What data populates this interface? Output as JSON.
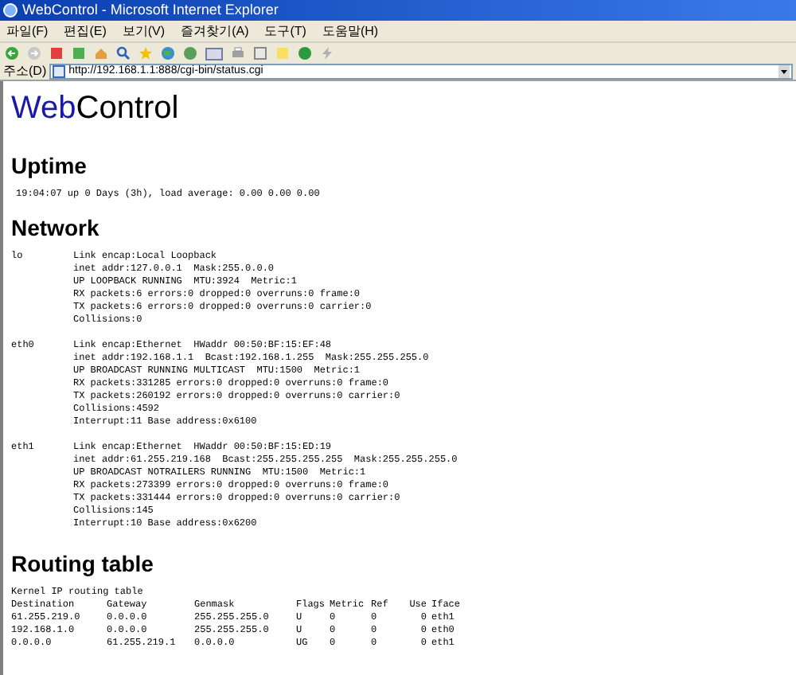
{
  "window": {
    "title": "WebControl - Microsoft Internet Explorer"
  },
  "menu": [
    "파일(F)",
    "편집(E)",
    "보기(V)",
    "즐겨찾기(A)",
    "도구(T)",
    "도움말(H)"
  ],
  "address_bar": {
    "label": "주소(D)",
    "value": "http://192.168.1.1:888/cgi-bin/status.cgi"
  },
  "page": {
    "logo": [
      {
        "text": "Web",
        "kind": "accent"
      },
      {
        "text": "Control",
        "kind": "plain"
      }
    ],
    "uptime": {
      "heading": "Uptime",
      "text": "19:04:07 up 0 Days (3h), load average: 0.00 0.00 0.00"
    },
    "network": {
      "heading": "Network",
      "interfaces": [
        {
          "name": "lo",
          "lines": [
            "Link encap:Local Loopback",
            "inet addr:127.0.0.1  Mask:255.0.0.0",
            "UP LOOPBACK RUNNING  MTU:3924  Metric:1",
            "RX packets:6 errors:0 dropped:0 overruns:0 frame:0",
            "TX packets:6 errors:0 dropped:0 overruns:0 carrier:0",
            "Collisions:0"
          ]
        },
        {
          "name": "eth0",
          "lines": [
            "Link encap:Ethernet  HWaddr 00:50:BF:15:EF:48",
            "inet addr:192.168.1.1  Bcast:192.168.1.255  Mask:255.255.255.0",
            "UP BROADCAST RUNNING MULTICAST  MTU:1500  Metric:1",
            "RX packets:331285 errors:0 dropped:0 overruns:0 frame:0",
            "TX packets:260192 errors:0 dropped:0 overruns:0 carrier:0",
            "Collisions:4592",
            "Interrupt:11 Base address:0x6100"
          ]
        },
        {
          "name": "eth1",
          "lines": [
            "Link encap:Ethernet  HWaddr 00:50:BF:15:ED:19",
            "inet addr:61.255.219.168  Bcast:255.255.255.255  Mask:255.255.255.0",
            "UP BROADCAST NOTRAILERS RUNNING  MTU:1500  Metric:1",
            "RX packets:273399 errors:0 dropped:0 overruns:0 frame:0",
            "TX packets:331444 errors:0 dropped:0 overruns:0 carrier:0",
            "Collisions:145",
            "Interrupt:10 Base address:0x6200"
          ]
        }
      ]
    },
    "routing": {
      "heading": "Routing table",
      "caption": "Kernel IP routing table",
      "columns": [
        "Destination",
        "Gateway",
        "Genmask",
        "Flags",
        "Metric",
        "Ref",
        "Use",
        "Iface"
      ],
      "rows": [
        [
          "61.255.219.0",
          "0.0.0.0",
          "255.255.255.0",
          "U",
          "0",
          "0",
          "0",
          "eth1"
        ],
        [
          "192.168.1.0",
          "0.0.0.0",
          "255.255.255.0",
          "U",
          "0",
          "0",
          "0",
          "eth0"
        ],
        [
          "0.0.0.0",
          "61.255.219.1",
          "0.0.0.0",
          "UG",
          "0",
          "0",
          "0",
          "eth1"
        ]
      ]
    }
  }
}
